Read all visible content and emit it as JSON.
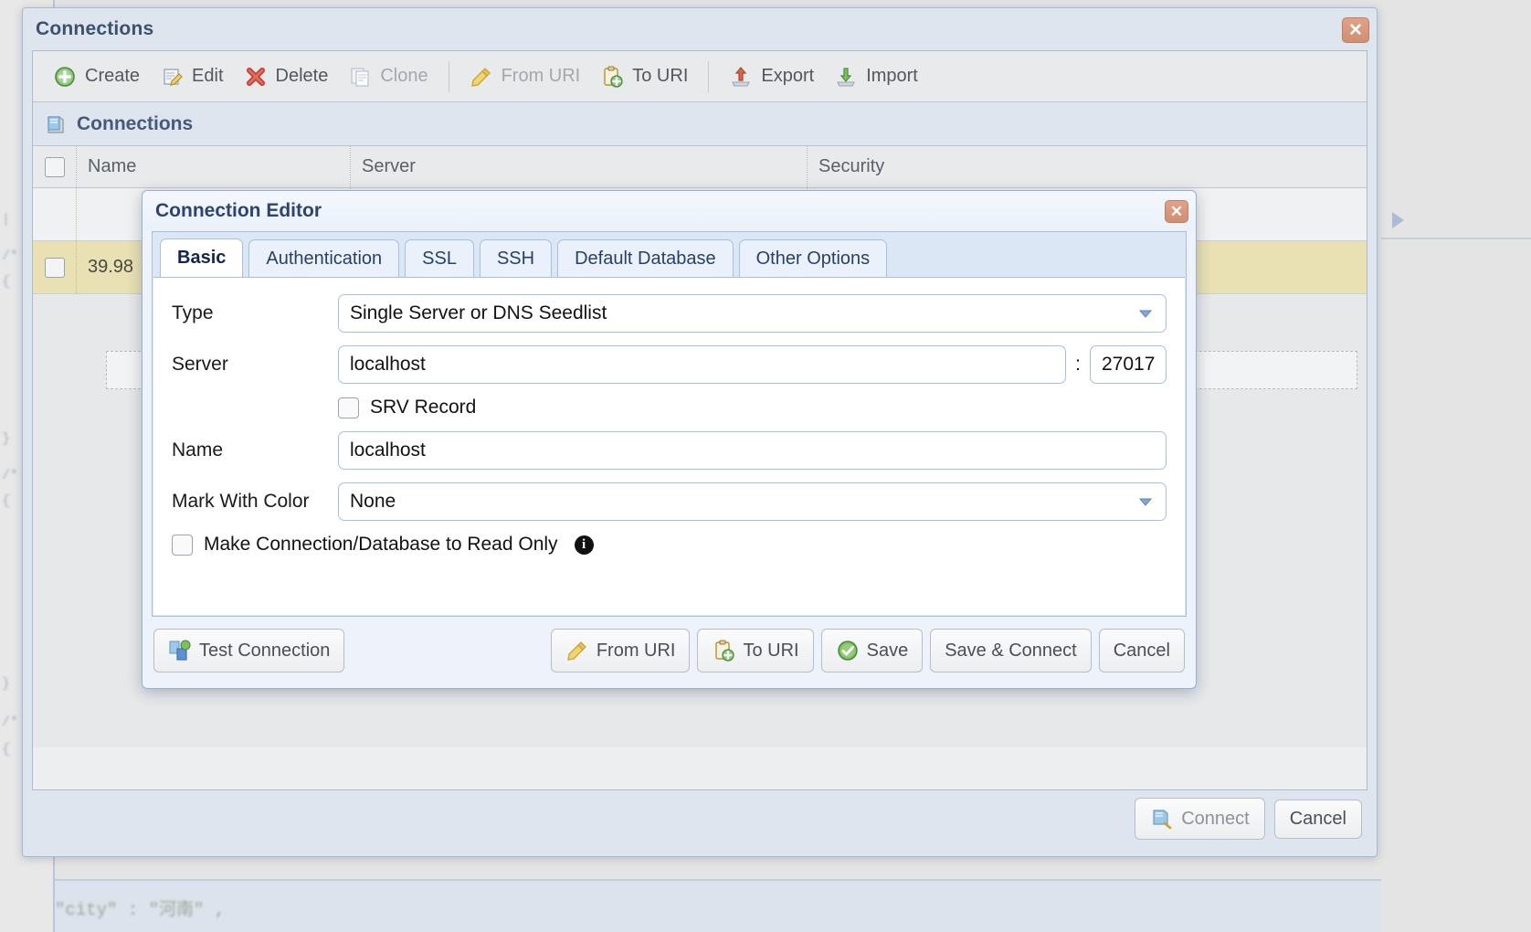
{
  "window": {
    "title": "Connections",
    "close_icon": "close-icon",
    "toolbar": [
      {
        "label": "Create",
        "icon": "plus-circle-green-icon",
        "disabled": false
      },
      {
        "label": "Edit",
        "icon": "pencil-note-icon",
        "disabled": false
      },
      {
        "label": "Delete",
        "icon": "red-x-icon",
        "disabled": false
      },
      {
        "label": "Clone",
        "icon": "copy-pages-icon",
        "disabled": true
      },
      {
        "label": "From URI",
        "icon": "yellow-pencil-icon",
        "disabled": true
      },
      {
        "label": "To URI",
        "icon": "clipboard-plus-icon",
        "disabled": false
      },
      {
        "label": "Export",
        "icon": "export-arrow-icon",
        "disabled": false
      },
      {
        "label": "Import",
        "icon": "import-arrow-icon",
        "disabled": false
      }
    ],
    "section": {
      "title": "Connections",
      "icon": "database-server-icon"
    },
    "table": {
      "columns": [
        "Name",
        "Server",
        "Security"
      ],
      "rows": [
        {
          "name": "",
          "server": "",
          "security": "",
          "selected": false
        },
        {
          "name": "39.98",
          "server": "",
          "security": "",
          "selected": true
        }
      ]
    },
    "footer": {
      "connect_label": "Connect",
      "connect_icon": "database-connect-icon",
      "cancel_label": "Cancel"
    }
  },
  "dialog": {
    "title": "Connection Editor",
    "close_icon": "close-icon",
    "tabs": [
      {
        "label": "Basic",
        "active": true
      },
      {
        "label": "Authentication",
        "active": false
      },
      {
        "label": "SSL",
        "active": false
      },
      {
        "label": "SSH",
        "active": false
      },
      {
        "label": "Default Database",
        "active": false
      },
      {
        "label": "Other Options",
        "active": false
      }
    ],
    "fields": {
      "type_label": "Type",
      "type_value": "Single Server or DNS Seedlist",
      "server_label": "Server",
      "server_value": "localhost",
      "port_separator": ":",
      "port_value": "27017",
      "srv_label": "SRV Record",
      "srv_checked": false,
      "name_label": "Name",
      "name_value": "localhost",
      "color_label": "Mark With Color",
      "color_value": "None",
      "readonly_label": "Make Connection/Database to Read Only",
      "readonly_checked": false,
      "readonly_info_icon": "info-icon"
    },
    "buttons": {
      "test_label": "Test Connection",
      "test_icon": "servers-icon",
      "from_uri_label": "From URI",
      "from_uri_icon": "yellow-pencil-icon",
      "to_uri_label": "To URI",
      "to_uri_icon": "clipboard-plus-icon",
      "save_label": "Save",
      "save_icon": "green-check-icon",
      "save_connect_label": "Save & Connect",
      "cancel_label": "Cancel"
    }
  },
  "background": {
    "bottom_text": "\"city\" : \"河南\" ,",
    "code_lines": [
      "|",
      "/*",
      "{",
      "}",
      ";",
      "/*",
      "{",
      "}",
      ";",
      "/*",
      "{"
    ],
    "expand_arrow_icon": "triangle-right-icon"
  },
  "colors": {
    "accent": "#3c5070",
    "selected_row": "#e9e0b4",
    "dialog_header": "#2e4372",
    "close_button": "#d08f72"
  }
}
